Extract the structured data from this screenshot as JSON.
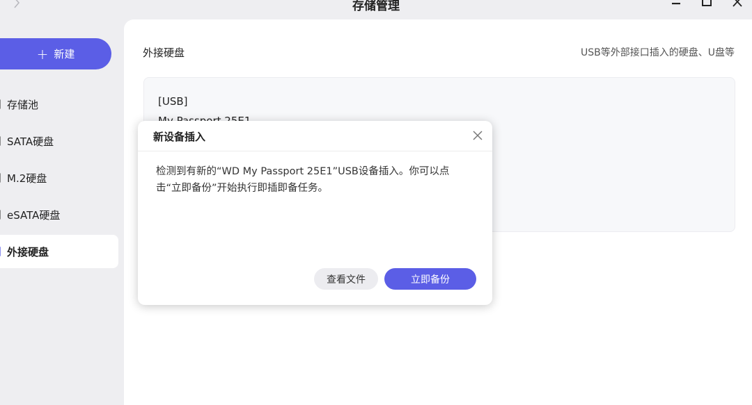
{
  "window": {
    "title": "存储管理",
    "back_icon": "chevron-right-icon",
    "controls": [
      "minimize-icon",
      "maximize-icon",
      "close-icon"
    ]
  },
  "sidebar": {
    "new_button": {
      "icon": "plus-icon",
      "label": "新建"
    },
    "items": [
      {
        "label": "存储池",
        "active": false
      },
      {
        "label": "SATA硬盘",
        "active": false
      },
      {
        "label": "M.2硬盘",
        "active": false
      },
      {
        "label": "eSATA硬盘",
        "active": false
      },
      {
        "label": "外接硬盘",
        "active": true
      }
    ]
  },
  "main": {
    "section_title": "外接硬盘",
    "section_desc": "USB等外部接口插入的硬盘、U盘等",
    "disk": {
      "type": "[USB]",
      "name": "My Passport 25E1"
    }
  },
  "dialog": {
    "title": "新设备插入",
    "message": "检测到有新的“WD My Passport 25E1”USB设备插入。你可以点击“立即备份”开始执行即插即备任务。",
    "secondary_button": "查看文件",
    "primary_button": "立即备份"
  },
  "colors": {
    "accent": "#5b5ee6",
    "background": "#eeeef1",
    "panel": "#ffffff"
  }
}
